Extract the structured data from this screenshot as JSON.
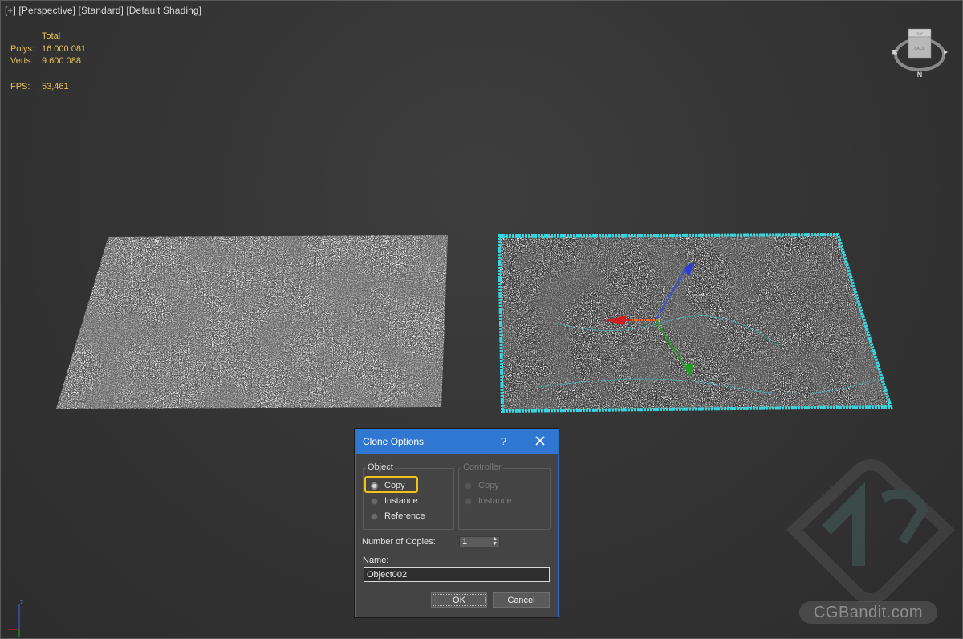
{
  "viewport": {
    "labels": [
      "[+]",
      "[Perspective]",
      "[Standard]",
      "[Default Shading]"
    ]
  },
  "stats": {
    "header": "Total",
    "polys_label": "Polys:",
    "polys_value": "16 000 081",
    "verts_label": "Verts:",
    "verts_value": "9 600 088",
    "fps_label": "FPS:",
    "fps_value": "53,461"
  },
  "viewcube": {
    "top_face": "TOP",
    "face": "BACK",
    "compass": "N"
  },
  "dialog": {
    "title": "Clone Options",
    "help": "?",
    "object_group": {
      "title": "Object",
      "options": [
        "Copy",
        "Instance",
        "Reference"
      ],
      "selected": "Copy"
    },
    "controller_group": {
      "title": "Controller",
      "options": [
        "Copy",
        "Instance"
      ],
      "enabled": false
    },
    "copies_label": "Number of Copies:",
    "copies_value": "1",
    "name_label": "Name:",
    "name_value": "Object002",
    "ok_label": "OK",
    "cancel_label": "Cancel"
  },
  "axis": {
    "z": "z"
  },
  "watermark": {
    "text": "CGBandit.com"
  },
  "colors": {
    "stats_text": "#e8c05a",
    "title_bar": "#2f77d0",
    "selection": "#36d6e0",
    "highlight": "#f2c21a"
  }
}
